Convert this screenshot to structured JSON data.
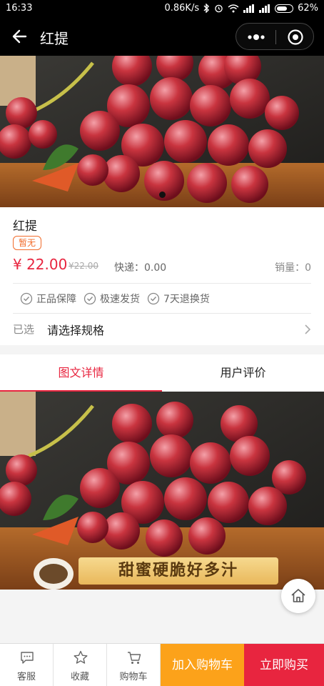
{
  "status_bar": {
    "time": "16:33",
    "network_speed": "0.86K/s",
    "battery": "62%"
  },
  "nav": {
    "title": "红提"
  },
  "product": {
    "name": "红提",
    "badge": "暂无",
    "price": "¥ 22.00",
    "original_price": "¥22.00",
    "shipping": "快递：0.00",
    "sales": "销量：0"
  },
  "guarantees": [
    "正品保障",
    "极速发货",
    "7天退换货"
  ],
  "spec": {
    "label": "已选",
    "value": "请选择规格"
  },
  "tabs": [
    {
      "label": "图文详情",
      "active": true
    },
    {
      "label": "用户评价",
      "active": false
    }
  ],
  "detail_caption": "甜蜜硬脆好多汁",
  "bottom_bar": {
    "service": "客服",
    "favorite": "收藏",
    "cart": "购物车",
    "add_to_cart": "加入购物车",
    "buy_now": "立即购买"
  },
  "colors": {
    "accent": "#e8253f",
    "orange": "#fca21a",
    "badge": "#f26b2a"
  }
}
